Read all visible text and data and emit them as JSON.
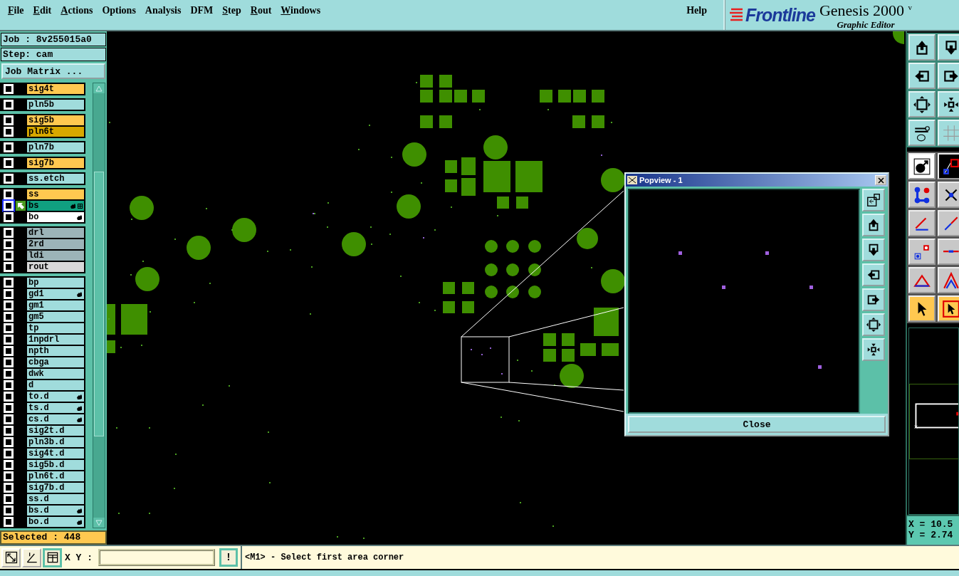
{
  "menu_bar": {
    "items": [
      {
        "label": "File",
        "mnemonic": true
      },
      {
        "label": "Edit",
        "mnemonic": true
      },
      {
        "label": "Actions",
        "mnemonic": true
      },
      {
        "label": "Options",
        "mnemonic": false
      },
      {
        "label": "Analysis",
        "mnemonic": false
      },
      {
        "label": "DFM",
        "mnemonic": false
      },
      {
        "label": "Step",
        "mnemonic": true
      },
      {
        "label": "Rout",
        "mnemonic": true
      },
      {
        "label": "Windows",
        "mnemonic": true
      }
    ],
    "help": "Help"
  },
  "logo": {
    "brand": "Frontline",
    "product": "Genesis 2000",
    "version": "v",
    "subtitle": "Graphic Editor"
  },
  "job_panel": {
    "job": "Job : 8v255015a0",
    "step": "Step: cam",
    "matrix_button": "Job Matrix ...",
    "layer_groups": [
      {
        "layers": [
          {
            "name": "sig4t",
            "color": "#ffc850",
            "checked": false,
            "active": false,
            "hand": false
          }
        ]
      },
      {
        "layers": [
          {
            "name": "pln5b",
            "color": "#a0dcdc",
            "checked": false,
            "active": false,
            "hand": false
          }
        ]
      },
      {
        "layers": [
          {
            "name": "sig5b",
            "color": "#ffc850",
            "checked": false,
            "active": false,
            "hand": false
          },
          {
            "name": "pln6t",
            "color": "#d8a800",
            "checked": false,
            "active": false,
            "hand": false
          }
        ]
      },
      {
        "layers": [
          {
            "name": "pln7b",
            "color": "#a0dcdc",
            "checked": false,
            "active": false,
            "hand": false
          }
        ]
      },
      {
        "layers": [
          {
            "name": "sig7b",
            "color": "#ffc850",
            "checked": false,
            "active": false,
            "hand": false
          }
        ]
      },
      {
        "layers": [
          {
            "name": "ss.etch",
            "color": "#a0dcdc",
            "checked": false,
            "active": false,
            "hand": false
          }
        ]
      },
      {
        "layers": [
          {
            "name": "ss",
            "color": "#ffc850",
            "checked": false,
            "active": false,
            "hand": false
          },
          {
            "name": "bs",
            "color": "#10a080",
            "checked": false,
            "active": true,
            "hand": true
          },
          {
            "name": "bo",
            "color": "#ffffff",
            "checked": false,
            "active": false,
            "hand": true
          }
        ]
      },
      {
        "layers": [
          {
            "name": "drl",
            "color": "#9cb4b8",
            "checked": false,
            "active": false,
            "hand": false
          },
          {
            "name": "2rd",
            "color": "#9cb4b8",
            "checked": false,
            "active": false,
            "hand": false
          },
          {
            "name": "ldi",
            "color": "#9cb4b8",
            "checked": false,
            "active": false,
            "hand": false
          },
          {
            "name": "rout",
            "color": "#d8d8d8",
            "checked": false,
            "active": false,
            "hand": false
          }
        ]
      },
      {
        "layers": [
          {
            "name": "bp",
            "color": "#a0dcdc",
            "checked": false,
            "active": false,
            "hand": false
          },
          {
            "name": "gd1",
            "color": "#a0dcdc",
            "checked": false,
            "active": false,
            "hand": true
          },
          {
            "name": "gm1",
            "color": "#a0dcdc",
            "checked": false,
            "active": false,
            "hand": false
          },
          {
            "name": "gm5",
            "color": "#a0dcdc",
            "checked": false,
            "active": false,
            "hand": false
          },
          {
            "name": "tp",
            "color": "#a0dcdc",
            "checked": false,
            "active": false,
            "hand": false
          },
          {
            "name": "1npdrl",
            "color": "#a0dcdc",
            "checked": false,
            "active": false,
            "hand": false
          },
          {
            "name": "npth",
            "color": "#a0dcdc",
            "checked": false,
            "active": false,
            "hand": false
          },
          {
            "name": "cbga",
            "color": "#a0dcdc",
            "checked": false,
            "active": false,
            "hand": false
          },
          {
            "name": "dwk",
            "color": "#a0dcdc",
            "checked": false,
            "active": false,
            "hand": false
          },
          {
            "name": "d",
            "color": "#a0dcdc",
            "checked": false,
            "active": false,
            "hand": false
          },
          {
            "name": "to.d",
            "color": "#a0dcdc",
            "checked": false,
            "active": false,
            "hand": true
          },
          {
            "name": "ts.d",
            "color": "#a0dcdc",
            "checked": false,
            "active": false,
            "hand": true
          },
          {
            "name": "cs.d",
            "color": "#a0dcdc",
            "checked": false,
            "active": false,
            "hand": true
          },
          {
            "name": "sig2t.d",
            "color": "#a0dcdc",
            "checked": false,
            "active": false,
            "hand": false
          },
          {
            "name": "pln3b.d",
            "color": "#a0dcdc",
            "checked": false,
            "active": false,
            "hand": false
          },
          {
            "name": "sig4t.d",
            "color": "#a0dcdc",
            "checked": false,
            "active": false,
            "hand": false
          },
          {
            "name": "sig5b.d",
            "color": "#a0dcdc",
            "checked": false,
            "active": false,
            "hand": false
          },
          {
            "name": "pln6t.d",
            "color": "#a0dcdc",
            "checked": false,
            "active": false,
            "hand": false
          },
          {
            "name": "sig7b.d",
            "color": "#a0dcdc",
            "checked": false,
            "active": false,
            "hand": false
          },
          {
            "name": "ss.d",
            "color": "#a0dcdc",
            "checked": false,
            "active": false,
            "hand": false
          },
          {
            "name": "bs.d",
            "color": "#a0dcdc",
            "checked": false,
            "active": false,
            "hand": true
          },
          {
            "name": "bo.d",
            "color": "#a0dcdc",
            "checked": false,
            "active": false,
            "hand": true
          }
        ]
      }
    ],
    "selected": "Selected : 448"
  },
  "popview": {
    "title": "Popview - 1",
    "close_button": "Close",
    "tools": [
      {
        "kind": "window-arrow"
      },
      {
        "kind": "up"
      },
      {
        "kind": "down"
      },
      {
        "kind": "left"
      },
      {
        "kind": "right"
      },
      {
        "kind": "expand"
      },
      {
        "kind": "contract"
      }
    ]
  },
  "tool_palette": {
    "groups": [
      {
        "buttons": [
          {
            "kind": "up",
            "selected": false
          },
          {
            "kind": "down",
            "selected": false
          },
          {
            "kind": "left",
            "selected": false
          },
          {
            "kind": "right",
            "selected": false
          },
          {
            "kind": "expand",
            "selected": false
          },
          {
            "kind": "contract",
            "selected": false
          },
          {
            "kind": "wrench",
            "selected": false
          },
          {
            "kind": "grid",
            "selected": false
          }
        ]
      },
      {
        "buttons": [
          {
            "kind": "circle-arrow",
            "selected": false
          },
          {
            "kind": "squares-line",
            "selected": false
          },
          {
            "kind": "nodes",
            "selected": false
          },
          {
            "kind": "cross",
            "selected": false
          },
          {
            "kind": "line-angle",
            "selected": false
          },
          {
            "kind": "line-arrow",
            "selected": false
          },
          {
            "kind": "squares-arrow",
            "selected": false
          },
          {
            "kind": "dash-line",
            "selected": false
          },
          {
            "kind": "triangle",
            "selected": false
          },
          {
            "kind": "double-triangle",
            "selected": false
          },
          {
            "kind": "pointer",
            "selected": true
          },
          {
            "kind": "pointer-frame",
            "selected": true
          }
        ]
      }
    ]
  },
  "coordinates": {
    "x": "X = 10.5",
    "y": "Y = 2.74"
  },
  "status_bar": {
    "tools": [
      {
        "kind": "zoom-arrow",
        "selected": false
      },
      {
        "kind": "angle",
        "selected": false
      },
      {
        "kind": "grid-window",
        "selected": true
      }
    ],
    "xy_label": "X Y :",
    "alert_button": "!",
    "message": "<M1> - Select first area corner"
  }
}
